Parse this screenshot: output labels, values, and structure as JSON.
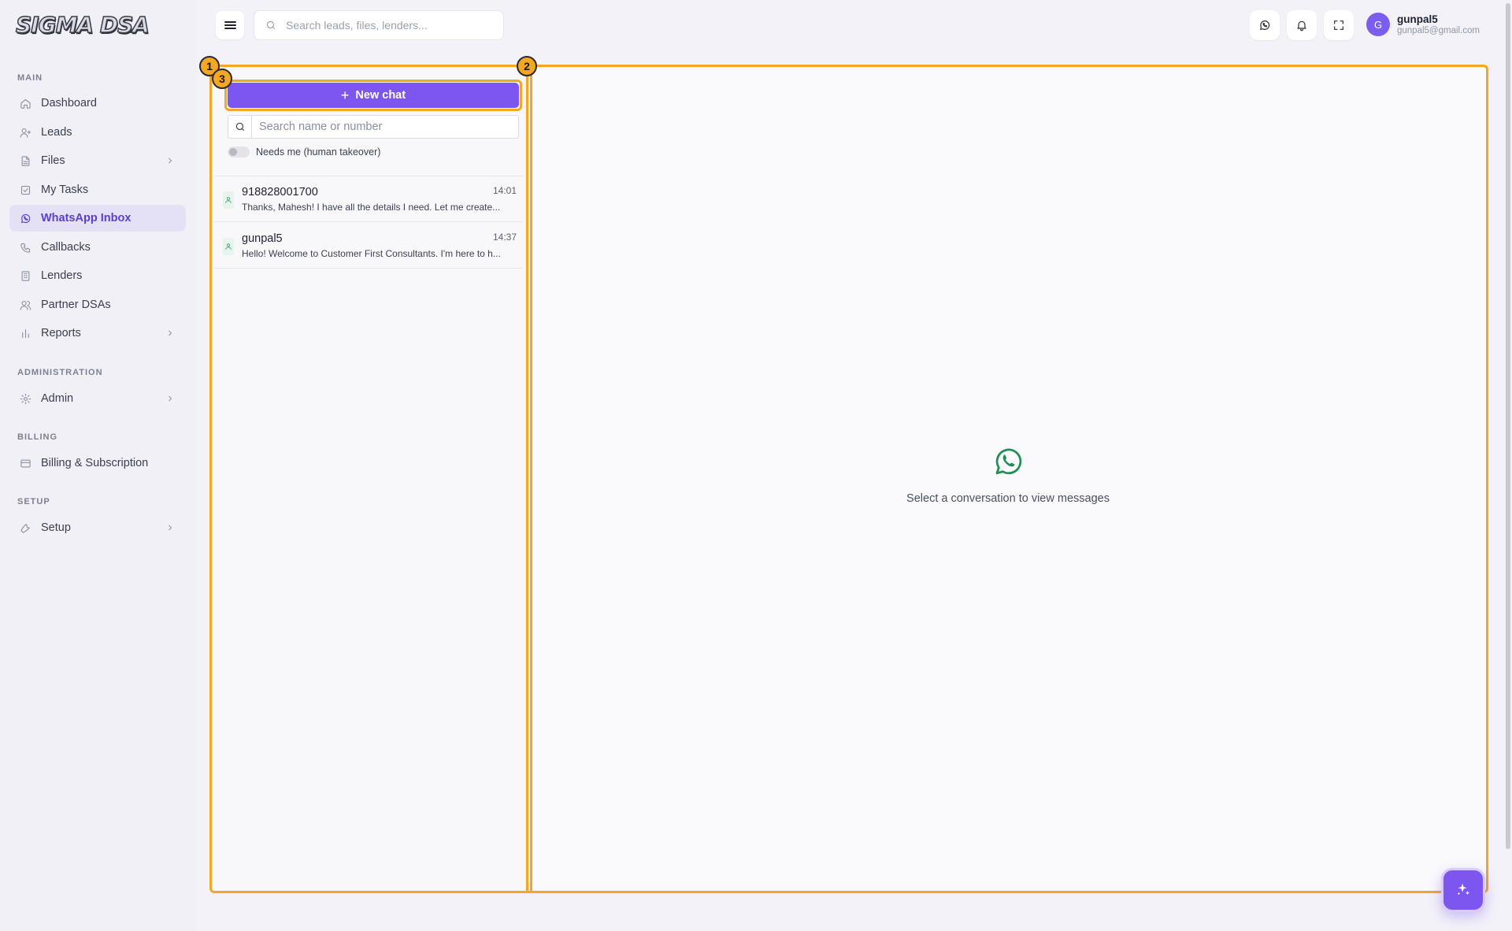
{
  "app": {
    "logo_text": "SIGMA DSA"
  },
  "sidebar": {
    "sections": [
      {
        "title": "MAIN"
      },
      {
        "title": "ADMINISTRATION"
      },
      {
        "title": "BILLING"
      },
      {
        "title": "SETUP"
      }
    ],
    "items": [
      {
        "label": "Dashboard",
        "icon": "home-icon"
      },
      {
        "label": "Leads",
        "icon": "user-plus-icon"
      },
      {
        "label": "Files",
        "icon": "file-icon",
        "has_submenu": true
      },
      {
        "label": "My Tasks",
        "icon": "checkbox-icon"
      },
      {
        "label": "WhatsApp Inbox",
        "icon": "whatsapp-icon",
        "active": true
      },
      {
        "label": "Callbacks",
        "icon": "phone-icon"
      },
      {
        "label": "Lenders",
        "icon": "building-icon"
      },
      {
        "label": "Partner DSAs",
        "icon": "users-icon"
      },
      {
        "label": "Reports",
        "icon": "bar-chart-icon",
        "has_submenu": true
      },
      {
        "label": "Admin",
        "icon": "gear-icon",
        "has_submenu": true
      },
      {
        "label": "Billing & Subscription",
        "icon": "credit-card-icon"
      },
      {
        "label": "Setup",
        "icon": "wrench-icon",
        "has_submenu": true
      }
    ]
  },
  "header": {
    "search_placeholder": "Search leads, files, lenders...",
    "user": {
      "initial": "G",
      "name": "gunpal5",
      "email": "gunpal5@gmail.com"
    }
  },
  "chat_list": {
    "new_chat_label": "New chat",
    "search_placeholder": "Search name or number",
    "toggle_label": "Needs me (human takeover)",
    "toggle_on": false,
    "conversations": [
      {
        "name": "918828001700",
        "time": "14:01",
        "preview": "Thanks, Mahesh! I have all the details I need. Let me create..."
      },
      {
        "name": "gunpal5",
        "time": "14:37",
        "preview": "Hello! Welcome to Customer First Consultants. I'm here to h..."
      }
    ]
  },
  "main": {
    "empty_text": "Select a conversation to view messages"
  },
  "annotations": {
    "badges": [
      "1",
      "2",
      "3"
    ]
  },
  "colors": {
    "accent": "#7c56ef",
    "highlight": "#f5a623",
    "whatsapp": "#1f8f55"
  }
}
